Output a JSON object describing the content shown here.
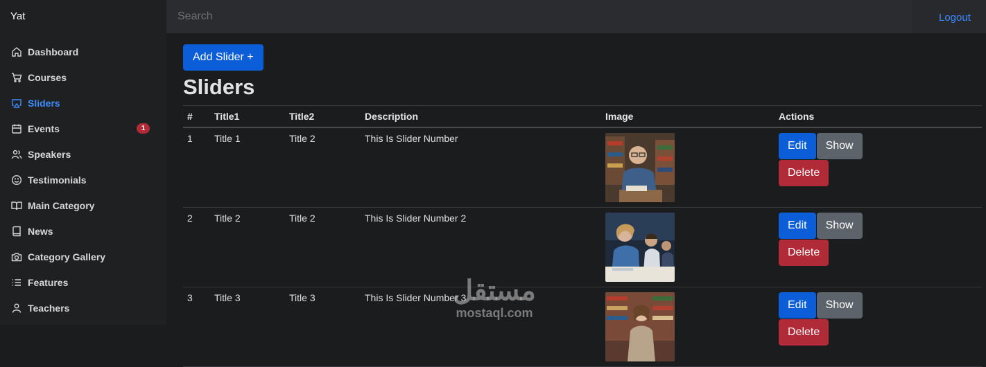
{
  "topbar": {
    "brand": "Yat",
    "search_placeholder": "Search",
    "logout": "Logout"
  },
  "sidebar": {
    "items": [
      {
        "label": "Dashboard",
        "icon": "home-icon"
      },
      {
        "label": "Courses",
        "icon": "cart-icon"
      },
      {
        "label": "Sliders",
        "icon": "airplay-icon",
        "active": true
      },
      {
        "label": "Events",
        "icon": "calendar-icon",
        "badge": "1"
      },
      {
        "label": "Speakers",
        "icon": "users-icon"
      },
      {
        "label": "Testimonials",
        "icon": "smile-icon"
      },
      {
        "label": "Main Category",
        "icon": "book-open-icon"
      },
      {
        "label": "News",
        "icon": "book-icon"
      },
      {
        "label": "Category Gallery",
        "icon": "camera-icon"
      },
      {
        "label": "Features",
        "icon": "list-icon"
      },
      {
        "label": "Teachers",
        "icon": "user-icon"
      }
    ]
  },
  "main": {
    "add_button": "Add Slider +",
    "title": "Sliders",
    "columns": [
      "#",
      "Title1",
      "Title2",
      "Description",
      "Image",
      "Actions"
    ],
    "rows": [
      {
        "id": "1",
        "title1": "Title 1",
        "title2": "Title 2",
        "description": "This Is Slider Number"
      },
      {
        "id": "2",
        "title1": "Title 2",
        "title2": "Title 2",
        "description": "This Is Slider Number 2"
      },
      {
        "id": "3",
        "title1": "Title 3",
        "title2": "Title 3",
        "description": "This Is Slider Number 3"
      }
    ],
    "actions": {
      "edit": "Edit",
      "show": "Show",
      "delete": "Delete"
    }
  },
  "watermark": {
    "arabic": "مستقل",
    "latin": "mostaql.com"
  },
  "colors": {
    "accent": "#3d8bfd",
    "primary": "#0b5ed7",
    "secondary": "#5c636a",
    "danger": "#b02a37"
  }
}
